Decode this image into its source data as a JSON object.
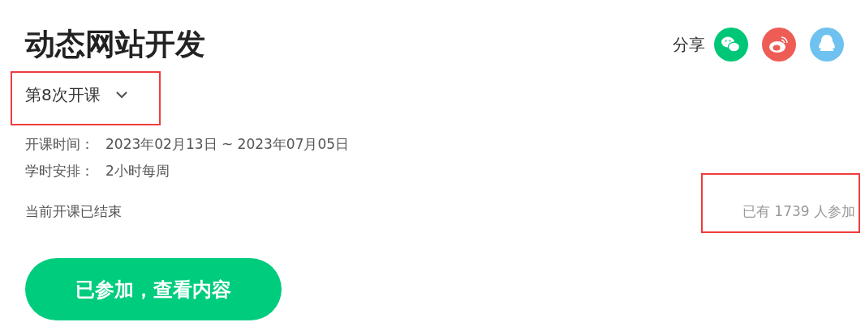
{
  "title": "动态网站开发",
  "share": {
    "label": "分享",
    "icons": [
      {
        "kind": "wechat",
        "color": "#00c777"
      },
      {
        "kind": "weibo",
        "color": "#ee5d55"
      },
      {
        "kind": "qq",
        "color": "#6fc2ef"
      }
    ]
  },
  "session_dropdown": {
    "value": "第8次开课",
    "highlighted": true
  },
  "info": [
    {
      "label": "开课时间：",
      "value": "2023年02月13日 ~ 2023年07月05日"
    },
    {
      "label": "学时安排：",
      "value": "2小时每周"
    }
  ],
  "status": "当前开课已结束",
  "participants": {
    "text": "已有 1739 人参加",
    "highlighted": true
  },
  "action_button": "已参加，查看内容"
}
